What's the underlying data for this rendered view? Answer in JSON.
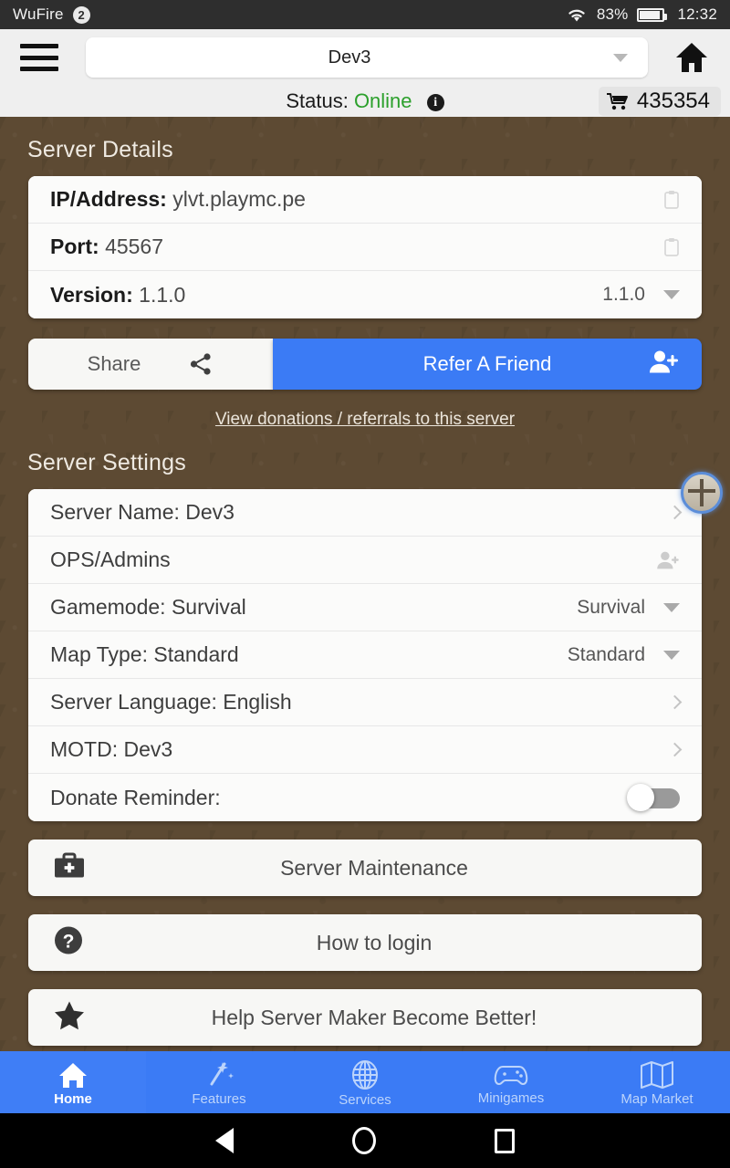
{
  "status_bar": {
    "app_name": "WuFire",
    "notification_count": "2",
    "wifi_icon": "wifi-icon",
    "battery_percent": "83%",
    "battery_icon": "battery-icon",
    "time": "12:32"
  },
  "header": {
    "menu_icon": "hamburger-menu-icon",
    "server_name": "Dev3",
    "dropdown_icon": "chevron-down-icon",
    "home_icon": "home-icon",
    "status_label": "Status:",
    "status_value": "Online",
    "status_color": "#2ca02c",
    "info_icon": "info-icon",
    "cart_icon": "cart-icon",
    "coins": "435354"
  },
  "server_details": {
    "title": "Server Details",
    "rows": [
      {
        "label": "IP/Address:",
        "value": "ylvt.playmc.pe",
        "trailing": "clipboard-icon"
      },
      {
        "label": "Port:",
        "value": "45567",
        "trailing": "clipboard-icon"
      },
      {
        "label": "Version:",
        "value": "1.1.0",
        "selected": "1.1.0",
        "trailing": "chevron-down-icon"
      }
    ]
  },
  "actions": {
    "share_label": "Share",
    "share_icon": "share-icon",
    "refer_label": "Refer A Friend",
    "refer_icon": "add-person-icon",
    "donate_link": "View donations / referrals to this server",
    "accent_color": "#3b7bf5"
  },
  "server_settings": {
    "title": "Server Settings",
    "rows": [
      {
        "label": "Server Name: Dev3",
        "trailing": "chevron-right-icon"
      },
      {
        "label": "OPS/Admins",
        "trailing": "add-person-icon"
      },
      {
        "label": "Gamemode: Survival",
        "selected": "Survival",
        "trailing": "chevron-down-icon"
      },
      {
        "label": "Map Type: Standard",
        "selected": "Standard",
        "trailing": "chevron-down-icon"
      },
      {
        "label": "Server Language: English",
        "trailing": "chevron-right-icon"
      },
      {
        "label": "MOTD: Dev3",
        "trailing": "chevron-right-icon"
      },
      {
        "label": "Donate Reminder:",
        "trailing": "toggle-switch",
        "toggle_state": "off"
      }
    ]
  },
  "action_buttons": [
    {
      "label": "Server Maintenance",
      "icon": "medkit-icon"
    },
    {
      "label": "How to login",
      "icon": "question-mark-icon"
    },
    {
      "label": "Help Server Maker Become Better!",
      "icon": "star-icon"
    }
  ],
  "bottom_nav": {
    "items": [
      {
        "label": "Home",
        "icon": "home-icon",
        "active": true
      },
      {
        "label": "Features",
        "icon": "magic-wand-icon",
        "active": false
      },
      {
        "label": "Services",
        "icon": "globe-icon",
        "active": false
      },
      {
        "label": "Minigames",
        "icon": "gamepad-icon",
        "active": false
      },
      {
        "label": "Map Market",
        "icon": "map-icon",
        "active": false
      }
    ]
  },
  "android_nav": {
    "back_icon": "back-triangle-icon",
    "home_icon": "home-circle-icon",
    "recent_icon": "recent-square-icon"
  },
  "floating_bubble": {
    "icon": "map-bubble-icon"
  }
}
